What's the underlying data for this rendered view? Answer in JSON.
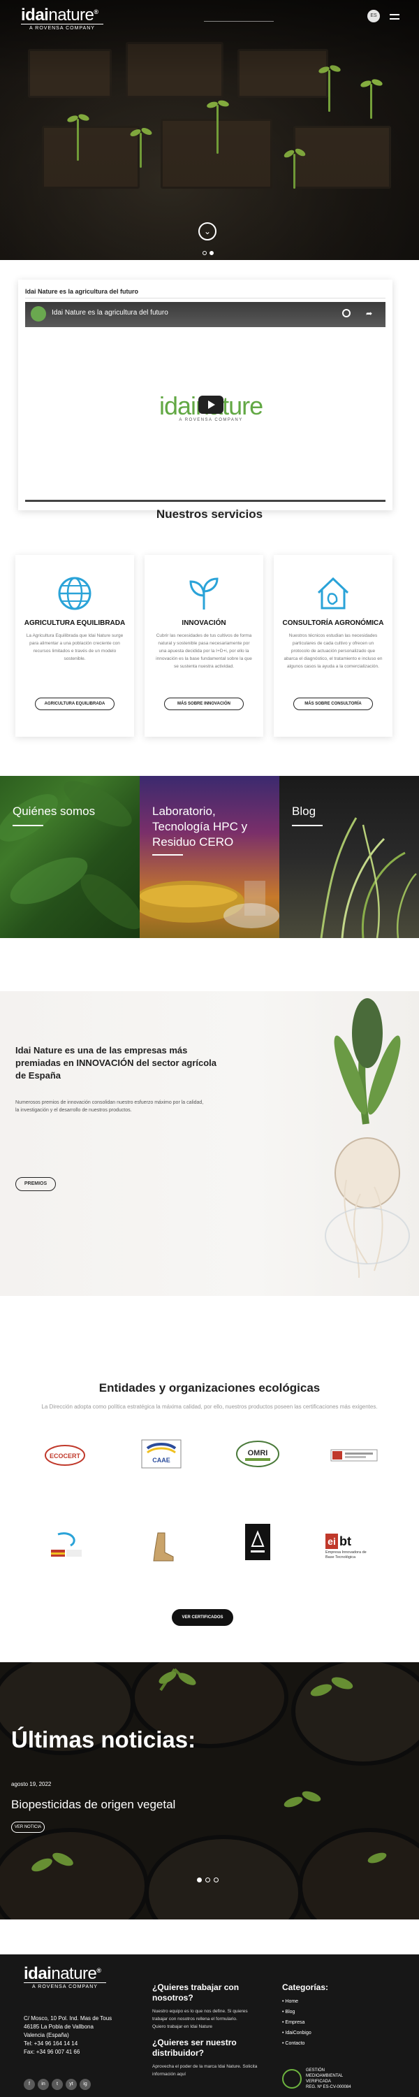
{
  "header": {
    "logo_word_bold": "idai",
    "logo_word_light": "nature",
    "logo_reg": "®",
    "logo_sub": "A ROVENSA COMPANY",
    "lang": "ES",
    "scroll_glyph": "⌄"
  },
  "video": {
    "caption": "Idai Nature es la agricultura del futuro",
    "title": "Idai Nature es la agricultura del futuro",
    "logo_text": "idainature",
    "logo_sub": "A ROVENSA COMPANY"
  },
  "services": {
    "title": "Nuestros servicios",
    "items": [
      {
        "icon": "globe-icon",
        "title": "AGRICULTURA EQUILIBRADA",
        "text": "La Agricultura Equilibrada que Idai Nature surge para alimentar a una población creciente con recursos limitados e través de un modelo sostenible.",
        "button": "AGRICULTURA EQUILIBRADA"
      },
      {
        "icon": "sprout-icon",
        "title": "INNOVACIÓN",
        "text": "Cubrir las necesidades de tus cultivos de forma natural y sostenible pasa necesariamente por una apuesta decidida por la I+D+i, por ello la innovación es la base fundamental sobre la que se sustenta nuestra actividad.",
        "button": "MÁS SOBRE INNOVACIÓN"
      },
      {
        "icon": "house-leaf-icon",
        "title": "CONSULTORÍA AGRONÓMICA",
        "text": "Nuestros técnicos estudian las necesidades particulares de cada cultivo y ofrecen un protocolo de actuación personalizado que abarca el diagnóstico, el tratamiento e incluso en algunos casos la ayuda a la comercialización.",
        "button": "MÁS SOBRE CONSULTORÍA"
      }
    ]
  },
  "tiles": [
    {
      "label": "Quiénes somos"
    },
    {
      "label": "Laboratorio, Tecnología HPC y Residuo CERO"
    },
    {
      "label": "Blog"
    }
  ],
  "awards": {
    "title": "Idai Nature es una de las empresas más premiadas en INNOVACIÓN del sector agrícola de España",
    "text": "Numerosos premios de innovación consolidan nuestro esfuerzo máximo por la calidad, la investigación y el desarrollo de nuestros productos.",
    "button": "PREMIOS"
  },
  "entities": {
    "title": "Entidades y organizaciones ecológicas",
    "subtitle": "La Dirección adopta como política estratégica la máxima calidad, por ello, nuestros productos poseen las certificaciones más exigentes.",
    "logos": [
      "ECOCERT",
      "CAAE",
      "OMRI",
      "",
      "",
      "",
      "",
      "bt"
    ],
    "logo_names": [
      "ecocert-logo",
      "caae-logo",
      "omri-logo",
      "bureau-veritas-logo",
      "ministerio-logo",
      "boot-logo",
      "arc-logo",
      "pyme-innovadora-logo"
    ],
    "pyme_text": "Empresa Innovadora de Base Tecnológica",
    "button": "VER CERTIFICADOS"
  },
  "news": {
    "title": "Últimas noticias:",
    "date": "agosto 19, 2022",
    "headline": "Biopesticidas de origen vegetal",
    "button": "VER NOTICIA"
  },
  "footer": {
    "address_lines": [
      "C/ Mosco, 10 Pol. Ind. Mas de Tous",
      "46185 La Pobla de Vallbona",
      "Valencia (España)",
      "Tel: +34 96 164 14 14",
      "Fax: +34 96 007 41 66"
    ],
    "work_title": "¿Quieres trabajar con nosotros?",
    "work_text": "Nuestro equipo es lo que nos define. Si quieres trabajar con nosotros rellena el formulario.",
    "work_link": "Quiero trabajar en Idai Nature",
    "dist_title": "¿Quieres ser nuestro distribuidor?",
    "dist_text": "Aprovecha el poder de la marca Idai Nature. Solicita información aquí",
    "cat_title": "Categorías:",
    "categories": [
      "Home",
      "Blog",
      "Empresa",
      "IdaiConbigo",
      "Contacto"
    ],
    "badge": [
      "GESTIÓN",
      "MEDIOAMBIENTAL",
      "VERIFICADA",
      "REG. Nº ES-CV-000084"
    ],
    "social": [
      "f",
      "in",
      "t",
      "yt",
      "ig"
    ]
  }
}
